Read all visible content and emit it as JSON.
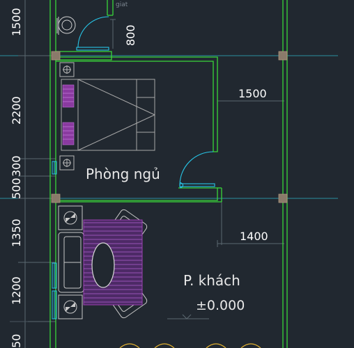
{
  "drawing": {
    "background": "#212830",
    "colors": {
      "wall": "#39d639",
      "inner_wall": "#2fa52f",
      "door": "#27c6e8",
      "grid": "#2a8fa0",
      "dim_line": "#5b6870",
      "column": "#8a7a6a",
      "furniture": "#c8c8c8",
      "rug": "#9a3fb0",
      "text": "#ffffff"
    },
    "fragment_label": "giat",
    "rooms": [
      {
        "id": "bedroom",
        "name": "Phòng ngủ"
      },
      {
        "id": "living",
        "name": "P. khách"
      }
    ],
    "level_label": "±0.000",
    "dimensions": {
      "door_width": "800",
      "bedroom_right": "1500",
      "living_right": "1400",
      "left": [
        "1500",
        "2200",
        "300",
        "500",
        "1350",
        "1200",
        "50"
      ]
    },
    "symbols": {
      "wc": "toilet-icon",
      "bed": "double-bed",
      "sofa": "sofa-set",
      "door": "swing-door-icon",
      "window": "window-icon"
    }
  }
}
